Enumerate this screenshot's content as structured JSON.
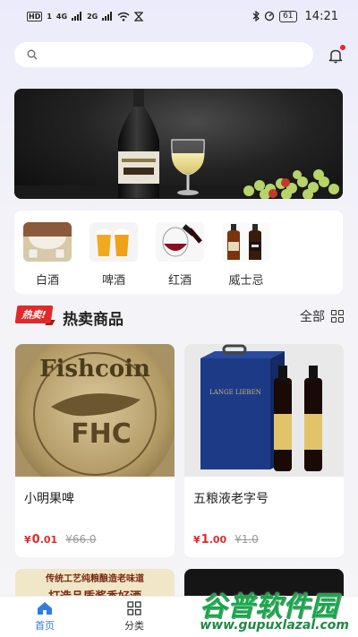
{
  "status_bar": {
    "left_chip": "HD",
    "left_num": "1",
    "signal_a": "4G",
    "signal_b": "2G",
    "battery": "61",
    "time": "14:21"
  },
  "search": {
    "placeholder": ""
  },
  "categories": [
    {
      "label": "白酒",
      "icon": "baijiu-image"
    },
    {
      "label": "啤酒",
      "icon": "beer-image"
    },
    {
      "label": "红酒",
      "icon": "red-wine-image"
    },
    {
      "label": "威士忌",
      "icon": "whisky-image"
    }
  ],
  "section": {
    "badge": "热卖!",
    "title": "热卖商品",
    "all_label": "全部"
  },
  "products": [
    {
      "name": "小明果啤",
      "price_symbol": "¥",
      "price_int": "0",
      "price_dec": ".01",
      "old_price": "¥66.0",
      "logo_text": "Fishcoin",
      "logo_mark": "FHC"
    },
    {
      "name": "五粮液老字号",
      "price_symbol": "¥",
      "price_int": "1",
      "price_dec": ".00",
      "old_price": "¥1.0",
      "box_text": "LANGE LIEBEN"
    }
  ],
  "peek": {
    "card1_line1": "传统工艺纯粮酿造老味道",
    "card1_line2": "打造品质酱香好酒"
  },
  "tabs": [
    {
      "label": "首页",
      "icon": "home-icon",
      "active": true
    },
    {
      "label": "分类",
      "icon": "category-icon",
      "active": false
    }
  ],
  "watermark": {
    "name": "谷普软件园",
    "url": "www.gupuxlazal.com"
  },
  "colors": {
    "accent": "#2f7be6",
    "price": "#e02a2a",
    "badge": "#e02a2a"
  }
}
